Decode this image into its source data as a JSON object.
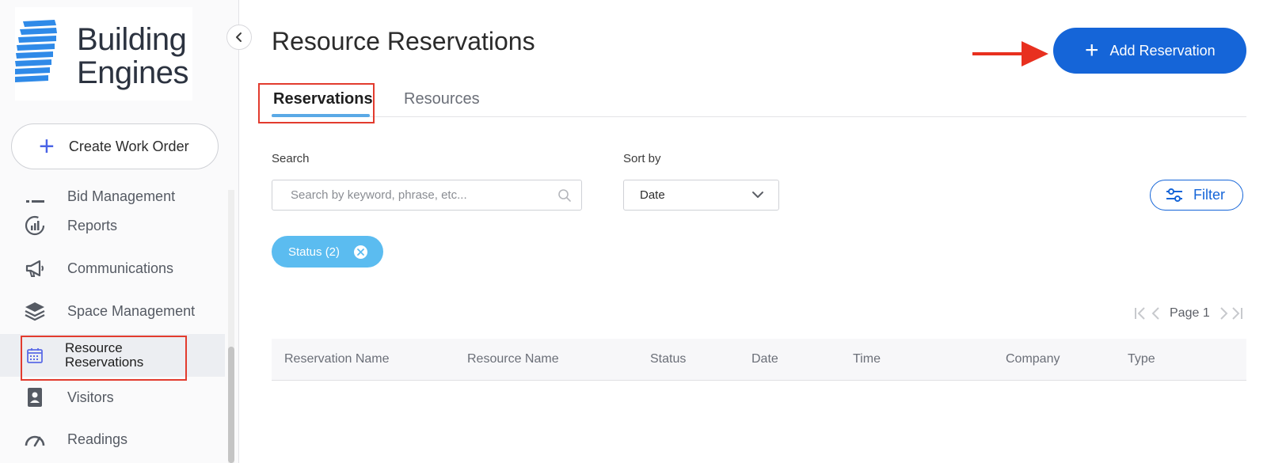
{
  "sidebar": {
    "logo_line1": "Building",
    "logo_line2": "Engines",
    "create_label": "Create Work Order",
    "items": [
      {
        "label": "Bid Management",
        "icon": "list-icon"
      },
      {
        "label": "Reports",
        "icon": "chart-icon"
      },
      {
        "label": "Communications",
        "icon": "megaphone-icon"
      },
      {
        "label": "Space Management",
        "icon": "layers-icon"
      },
      {
        "label": "Resource Reservations",
        "icon": "calendar-icon"
      },
      {
        "label": "Visitors",
        "icon": "badge-icon"
      },
      {
        "label": "Readings",
        "icon": "gauge-icon"
      }
    ]
  },
  "main": {
    "title": "Resource Reservations",
    "add_label": "Add Reservation",
    "tabs": [
      {
        "label": "Reservations",
        "active": true
      },
      {
        "label": "Resources",
        "active": false
      }
    ],
    "search_label": "Search",
    "search_placeholder": "Search by keyword, phrase, etc...",
    "sort_label": "Sort by",
    "sort_value": "Date",
    "filter_label": "Filter",
    "chip_label": "Status (2)",
    "page_label": "Page 1",
    "columns": [
      "Reservation Name",
      "Resource Name",
      "Status",
      "Date",
      "Time",
      "Company",
      "Type"
    ]
  },
  "colors": {
    "primary": "#1565d8",
    "chip": "#5bbcf0",
    "annotation": "#e23b2e",
    "tab_underline": "#5aa9e6"
  }
}
